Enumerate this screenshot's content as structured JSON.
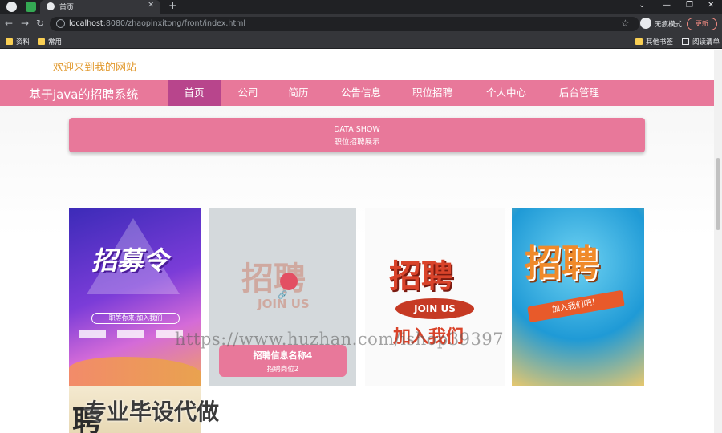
{
  "browser": {
    "tab_title": "首页",
    "url_host": "localhost",
    "url_rest": ":8080/zhaopinxitong/front/index.html",
    "incognito_label": "无痕模式",
    "update_label": "更新",
    "bookmarks": {
      "left": [
        "资料",
        "常用"
      ],
      "right": [
        "其他书签",
        "阅读清单"
      ]
    }
  },
  "site": {
    "welcome": "欢迎来到我的网站",
    "brand": "基于java的招聘系统",
    "nav": [
      "首页",
      "公司",
      "简历",
      "公告信息",
      "职位招聘",
      "个人中心",
      "后台管理"
    ],
    "active_nav": "首页"
  },
  "banner": {
    "title_en": "DATA SHOW",
    "title_cn": "职位招聘展示"
  },
  "cards": [
    {
      "poster": "招募令",
      "poster_sub": "职等你来·加入我们"
    },
    {
      "poster": "招聘",
      "poster_sub": "JOIN US",
      "overlay_title": "招聘信息名称4",
      "overlay_sub": "招聘岗位2"
    },
    {
      "poster": "招聘",
      "poster_sub": "JOIN US",
      "poster_bottom": "加入我们"
    },
    {
      "poster": "招聘",
      "poster_sub": "加入我们吧！"
    },
    {
      "poster": "聘"
    }
  ],
  "watermarks": {
    "url": "https://www.huzhan.com/ishop39397",
    "text": "专业毕设代做"
  },
  "colors": {
    "nav_bg": "#e8789a",
    "nav_active": "#b8458c",
    "welcome": "#e29a2f"
  }
}
